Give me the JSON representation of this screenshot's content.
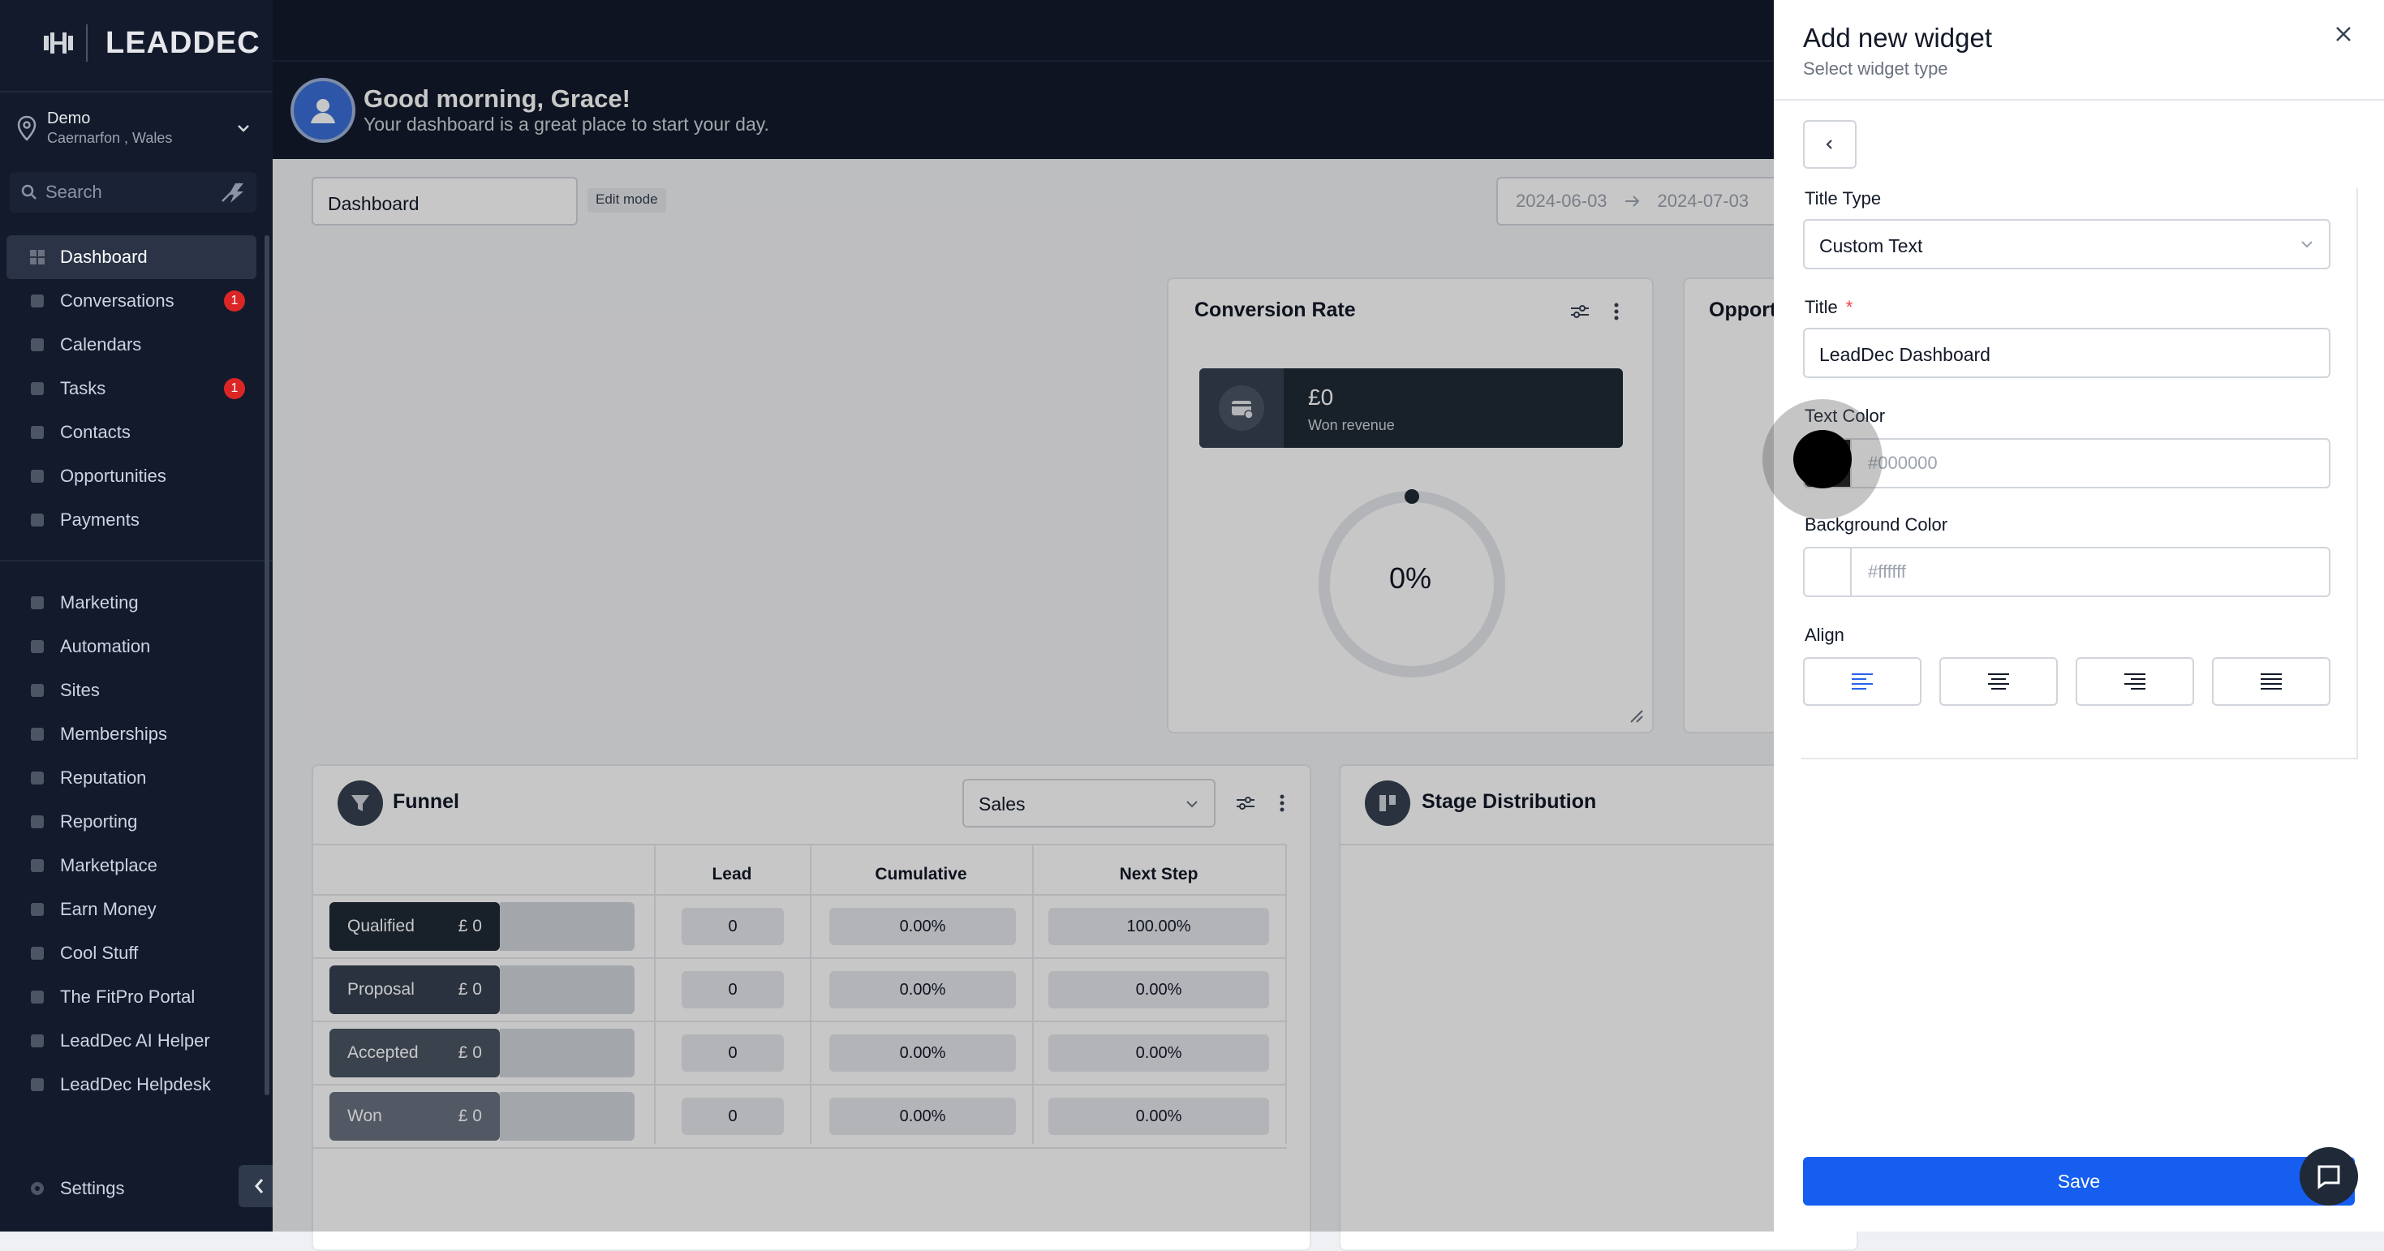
{
  "app": {
    "logo_text": "LEADDEC",
    "location": {
      "name": "Demo",
      "sub": "Caernarfon , Wales"
    },
    "search_placeholder": "Search"
  },
  "sidebar": {
    "items": [
      {
        "label": "Dashboard",
        "icon": "dashboard-icon",
        "active": true
      },
      {
        "label": "Conversations",
        "icon": "chat-icon",
        "badge": "1"
      },
      {
        "label": "Calendars",
        "icon": "calendar-icon"
      },
      {
        "label": "Tasks",
        "icon": "check-icon",
        "badge": "1"
      },
      {
        "label": "Contacts",
        "icon": "person-icon"
      },
      {
        "label": "Opportunities",
        "icon": "funnel-icon"
      },
      {
        "label": "Payments",
        "icon": "card-icon"
      },
      {
        "label": "Marketing",
        "icon": "megaphone-icon"
      },
      {
        "label": "Automation",
        "icon": "gear-icon"
      },
      {
        "label": "Sites",
        "icon": "globe-icon"
      },
      {
        "label": "Memberships",
        "icon": "people-icon"
      },
      {
        "label": "Reputation",
        "icon": "star-icon"
      },
      {
        "label": "Reporting",
        "icon": "chart-icon"
      },
      {
        "label": "Marketplace",
        "icon": "cart-icon"
      },
      {
        "label": "Earn Money",
        "icon": "money-icon"
      },
      {
        "label": "Cool Stuff",
        "icon": "fire-icon"
      },
      {
        "label": "The FitPro Portal",
        "icon": "dumbbell-icon"
      },
      {
        "label": "LeadDec AI Helper",
        "icon": "robot-icon"
      },
      {
        "label": "LeadDec Helpdesk",
        "icon": "info-icon"
      }
    ],
    "settings_label": "Settings"
  },
  "header": {
    "greeting": "Good morning, Grace!",
    "subtitle": "Your dashboard is a great place to start your day."
  },
  "main": {
    "dashboard_select": "Dashboard",
    "edit_mode": "Edit mode",
    "date_start": "2024-06-03",
    "date_end": "2024-07-03",
    "conversion": {
      "title": "Conversion Rate",
      "won_value": "£0",
      "won_label": "Won revenue",
      "percent": "0%"
    },
    "opportunities_title": "Opport",
    "funnel": {
      "title": "Funnel",
      "pipeline": "Sales",
      "headers": [
        "Lead",
        "Cumulative",
        "Next Step"
      ],
      "rows": [
        {
          "stage": "Qualified",
          "value": "£ 0",
          "lead": "0",
          "cumulative": "0.00%",
          "next": "100.00%",
          "color": "#1f2937"
        },
        {
          "stage": "Proposal",
          "value": "£ 0",
          "lead": "0",
          "cumulative": "0.00%",
          "next": "0.00%",
          "color": "#374151"
        },
        {
          "stage": "Accepted",
          "value": "£ 0",
          "lead": "0",
          "cumulative": "0.00%",
          "next": "0.00%",
          "color": "#4b5563"
        },
        {
          "stage": "Won",
          "value": "£ 0",
          "lead": "0",
          "cumulative": "0.00%",
          "next": "0.00%",
          "color": "#6b7280"
        }
      ]
    },
    "stage_distribution_title": "Stage Distribution"
  },
  "drawer": {
    "title": "Add new widget",
    "subtitle": "Select widget type",
    "title_type_label": "Title Type",
    "title_type_value": "Custom Text",
    "title_label": "Title",
    "title_required": "*",
    "title_value": "LeadDec Dashboard",
    "text_color_label": "Text Color",
    "text_color_placeholder": "#000000",
    "text_color_value": "#000000",
    "bg_color_label": "Background Color",
    "bg_color_placeholder": "#ffffff",
    "bg_color_value": "#ffffff",
    "align_label": "Align",
    "align_options": [
      "left",
      "center",
      "right",
      "justify"
    ],
    "align_selected": "left",
    "save_label": "Save"
  },
  "colors": {
    "accent": "#155eef",
    "sidebar_bg": "#121a2b",
    "badge": "#dc2626"
  }
}
